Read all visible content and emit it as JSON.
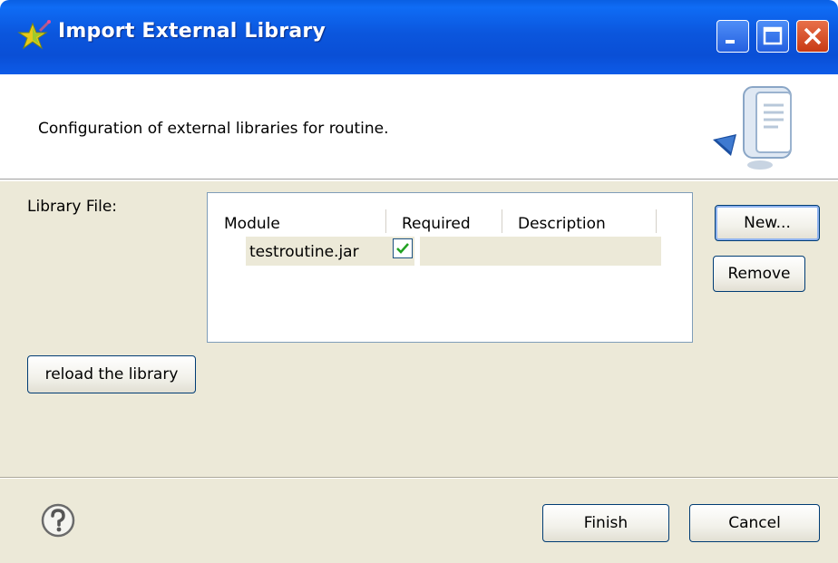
{
  "window": {
    "title": "Import External Library",
    "controls": {
      "minimize": "minimize-icon",
      "maximize": "maximize-icon",
      "close": "close-icon"
    }
  },
  "banner": {
    "description": "Configuration of external libraries for routine."
  },
  "library": {
    "label": "Library File:",
    "columns": [
      "Module",
      "Required",
      "Description"
    ],
    "rows": [
      {
        "module": "testroutine.jar",
        "required": true,
        "description": ""
      }
    ]
  },
  "buttons": {
    "new": "New...",
    "remove": "Remove",
    "reload": "reload the library",
    "finish": "Finish",
    "cancel": "Cancel"
  },
  "colors": {
    "titlebar": "#0a4fd6",
    "panel": "#ece9d8",
    "close_button": "#c83a14"
  }
}
